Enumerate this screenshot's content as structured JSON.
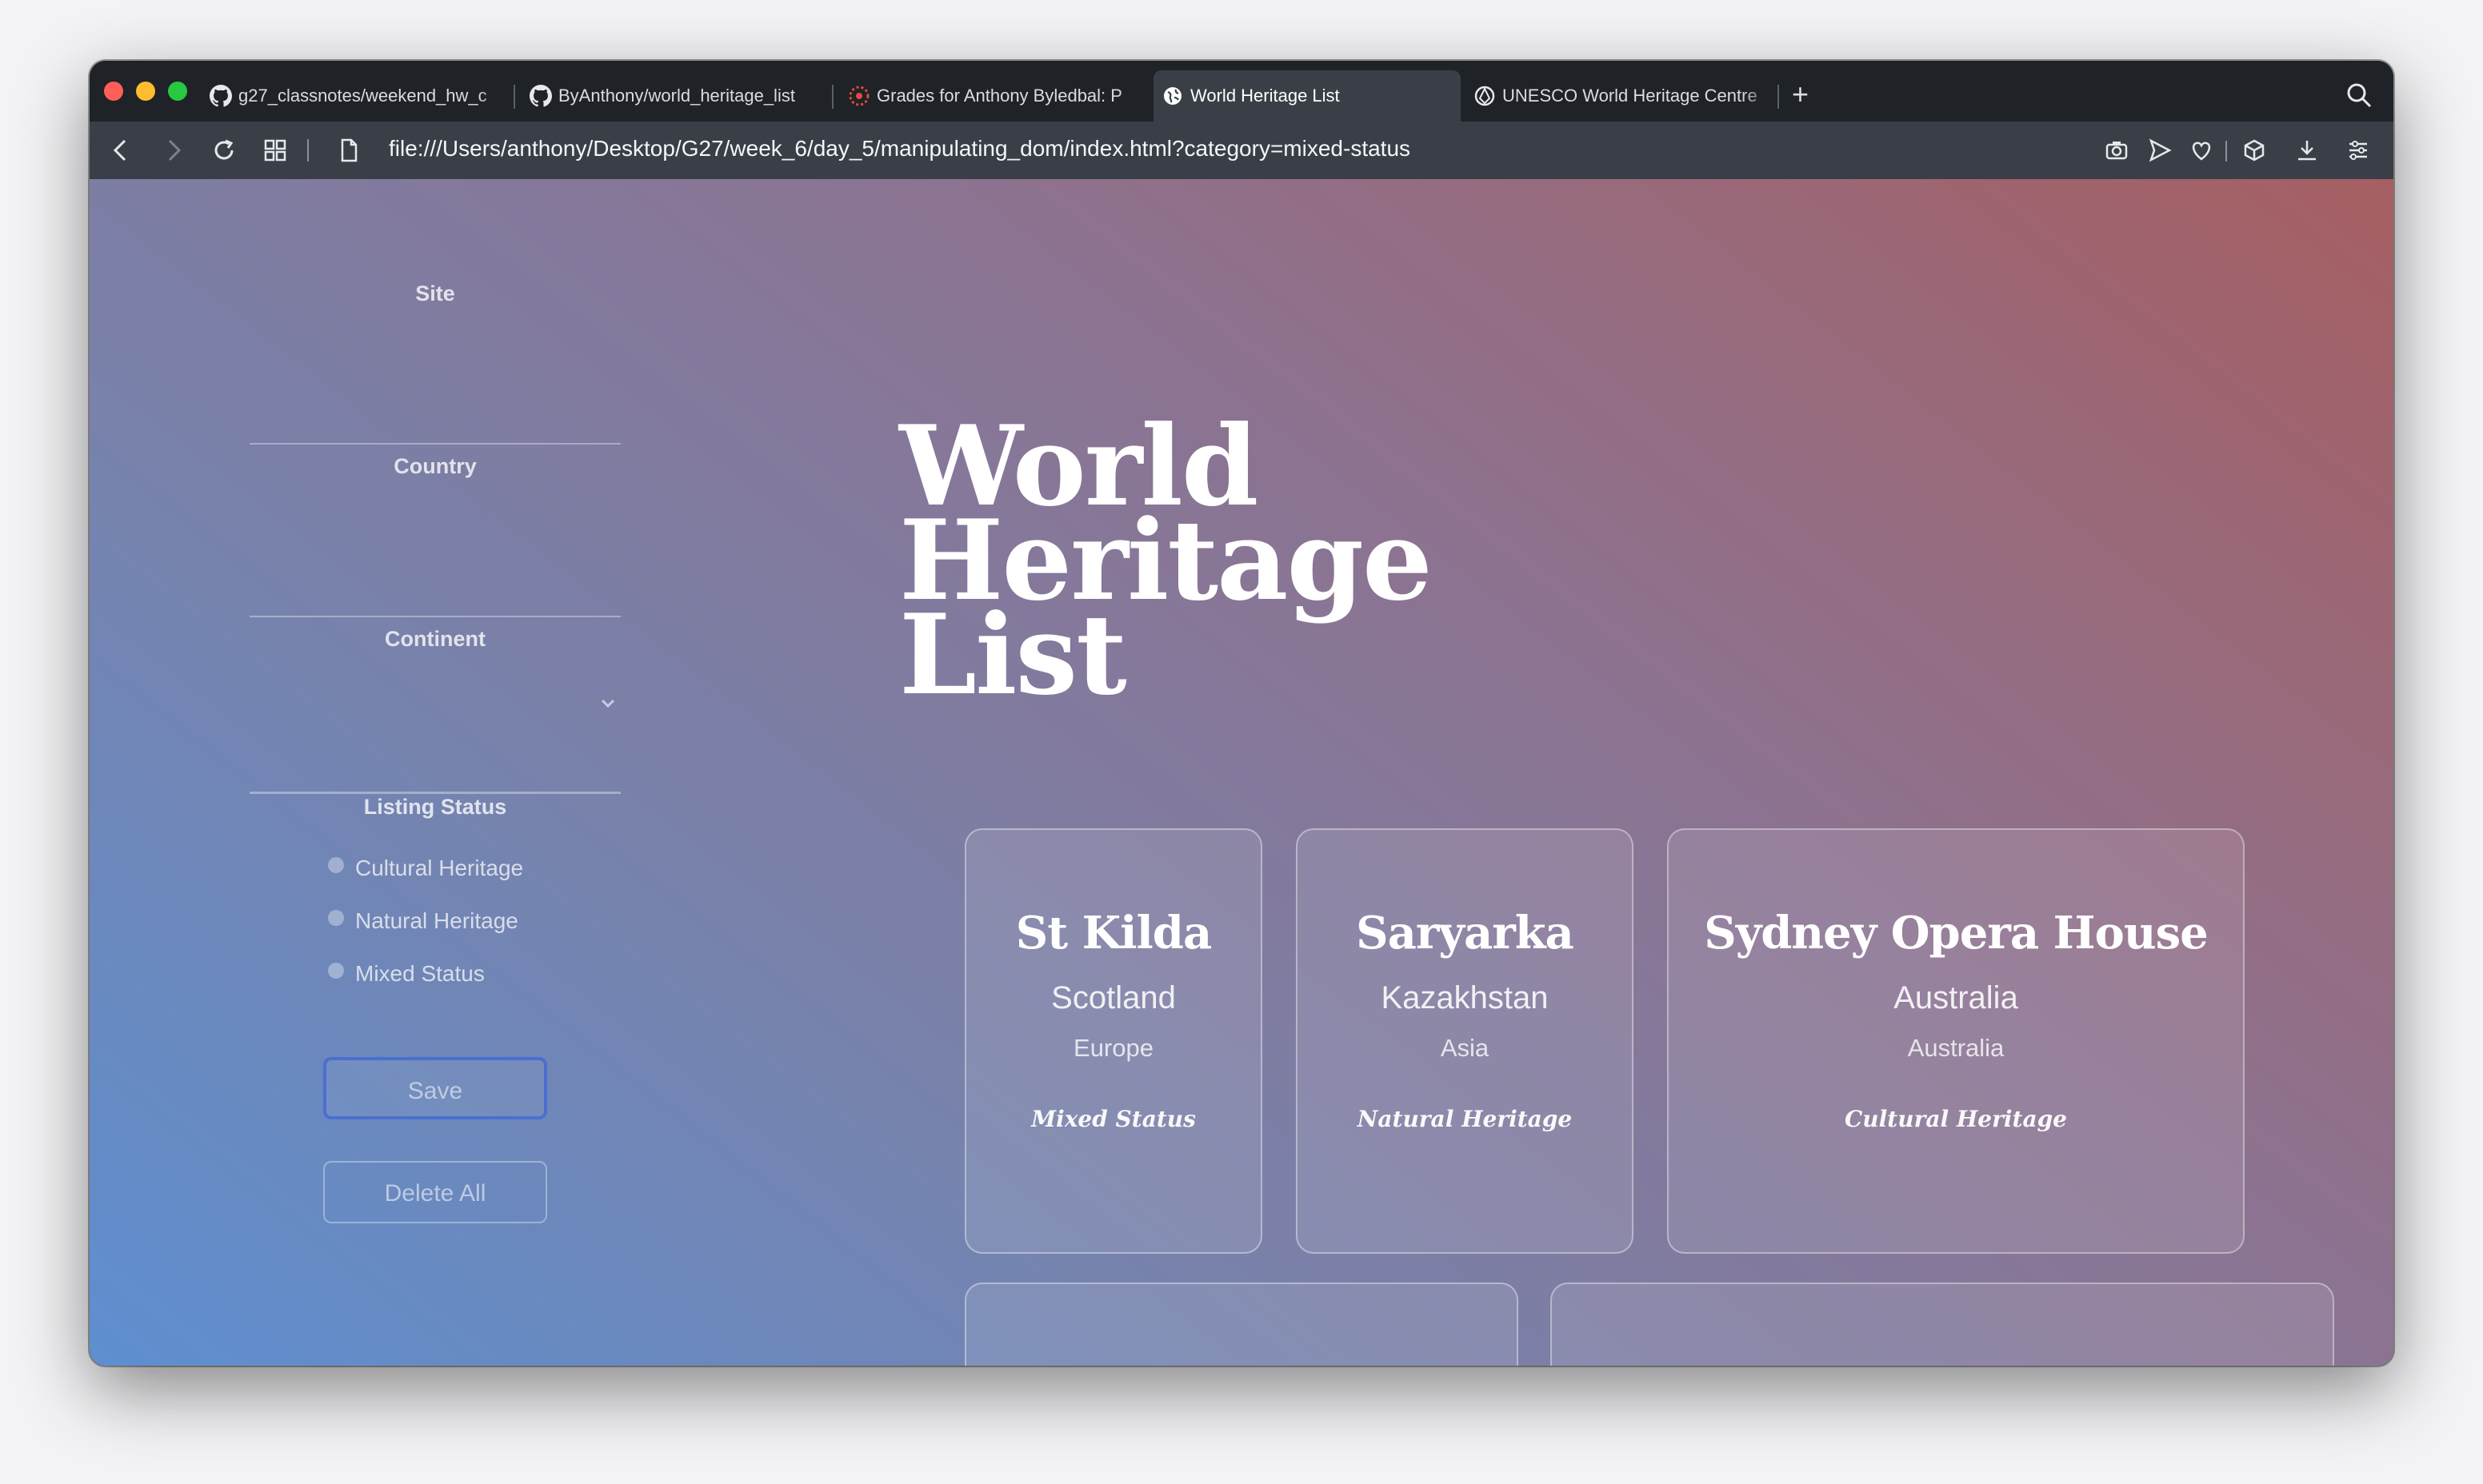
{
  "browser": {
    "tabs": [
      {
        "label": "g27_classnotes/weekend_hw_c",
        "icon": "github-icon"
      },
      {
        "label": "ByAnthony/world_heritage_list",
        "icon": "github-icon"
      },
      {
        "label": "Grades for Anthony Byledbal: P",
        "icon": "canvas-icon"
      },
      {
        "label": "World Heritage List",
        "icon": "globe-icon"
      },
      {
        "label": "UNESCO World Heritage Centre",
        "icon": "unesco-icon"
      }
    ],
    "new_tab": "+",
    "url": "file:///Users/anthony/Desktop/G27/week_6/day_5/manipulating_dom/index.html?category=mixed-status"
  },
  "form": {
    "site_label": "Site",
    "country_label": "Country",
    "continent_label": "Continent",
    "listing_status_label": "Listing Status",
    "statuses": [
      {
        "label": "Cultural Heritage"
      },
      {
        "label": "Natural Heritage"
      },
      {
        "label": "Mixed Status"
      }
    ],
    "save_label": "Save",
    "delete_label": "Delete All"
  },
  "title": {
    "line1": "World",
    "line2": "Heritage",
    "line3": "List"
  },
  "cards": [
    {
      "name": "St Kilda",
      "country": "Scotland",
      "continent": "Europe",
      "status": "Mixed Status"
    },
    {
      "name": "Saryarka",
      "country": "Kazakhstan",
      "continent": "Asia",
      "status": "Natural Heritage"
    },
    {
      "name": "Sydney Opera House",
      "country": "Australia",
      "continent": "Australia",
      "status": "Cultural Heritage"
    }
  ],
  "colors": {
    "gradient_blue": "#5e8fd0",
    "gradient_red": "#a65f62",
    "save_border": "#4b6fd0"
  }
}
